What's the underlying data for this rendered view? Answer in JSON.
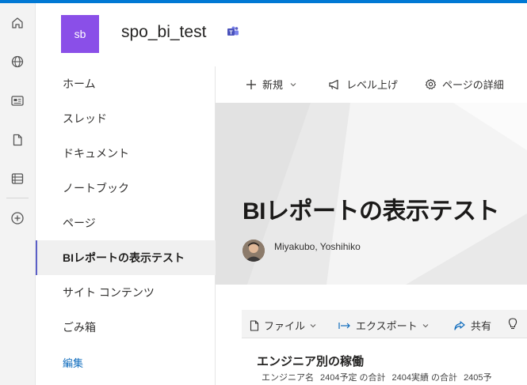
{
  "site": {
    "logo_initials": "sb",
    "logo_color": "#8a4fe8",
    "title": "spo_bi_test"
  },
  "rail": {
    "icons": [
      "home-icon",
      "globe-icon",
      "news-icon",
      "document-icon",
      "list-icon",
      "add-icon"
    ]
  },
  "nav": {
    "items": [
      {
        "label": "ホーム"
      },
      {
        "label": "スレッド"
      },
      {
        "label": "ドキュメント"
      },
      {
        "label": "ノートブック"
      },
      {
        "label": "ページ"
      },
      {
        "label": "BIレポートの表示テスト",
        "active": true
      },
      {
        "label": "サイト コンテンツ"
      },
      {
        "label": "ごみ箱"
      }
    ],
    "edit_label": "編集"
  },
  "commandbar": {
    "new_label": "新規",
    "promote_label": "レベル上げ",
    "details_label": "ページの詳細"
  },
  "hero": {
    "title": "BIレポートの表示テスト",
    "author": "Miyakubo, Yoshihiko"
  },
  "powerbi": {
    "file_label": "ファイル",
    "export_label": "エクスポート",
    "share_label": "共有",
    "report_title": "エンジニア別の稼働",
    "columns": [
      "エンジニア名",
      "2404予定 の合計",
      "2404実績 の合計",
      "2405予"
    ]
  },
  "colors": {
    "accent": "#0078d4",
    "nav_active_bar": "#5b5fc7",
    "edit_link": "#0f6cbd"
  }
}
